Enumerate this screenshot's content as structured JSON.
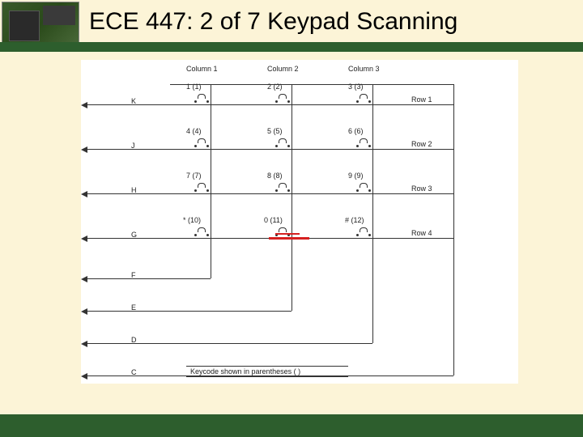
{
  "title": "ECE 447: 2 of 7 Keypad Scanning",
  "zero_label": "0",
  "columns": [
    {
      "label": "Column 1"
    },
    {
      "label": "Column 2"
    },
    {
      "label": "Column 3"
    }
  ],
  "rows": [
    {
      "label": "Row 1"
    },
    {
      "label": "Row 2"
    },
    {
      "label": "Row 3"
    },
    {
      "label": "Row 4"
    }
  ],
  "row_pins": [
    {
      "name": "K"
    },
    {
      "name": "J"
    },
    {
      "name": "H"
    },
    {
      "name": "G"
    }
  ],
  "col_pins": [
    {
      "name": "F"
    },
    {
      "name": "E"
    },
    {
      "name": "D"
    },
    {
      "name": "C"
    }
  ],
  "keys": [
    {
      "label": "1",
      "code": "(1)"
    },
    {
      "label": "2",
      "code": "(2)"
    },
    {
      "label": "3",
      "code": "(3)"
    },
    {
      "label": "4",
      "code": "(4)"
    },
    {
      "label": "5",
      "code": "(5)"
    },
    {
      "label": "6",
      "code": "(6)"
    },
    {
      "label": "7",
      "code": "(7)"
    },
    {
      "label": "8",
      "code": "(8)"
    },
    {
      "label": "9",
      "code": "(9)"
    },
    {
      "label": "*",
      "code": "(10)"
    },
    {
      "label": "0",
      "code": "(11)"
    },
    {
      "label": "#",
      "code": "(12)"
    }
  ],
  "keycode_note": "Keycode shown in parentheses ( )"
}
